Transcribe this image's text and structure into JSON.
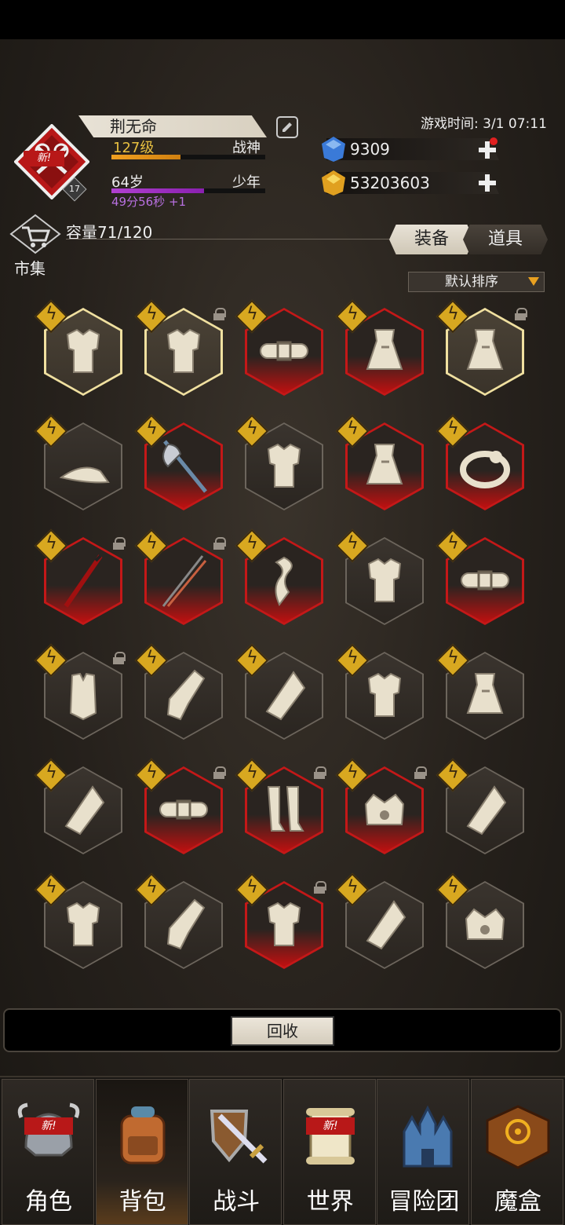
{
  "profile": {
    "name": "荆无命",
    "level": "127级",
    "title": "战神",
    "age": "64岁",
    "stage": "少年",
    "timer": "49分56秒 +1",
    "badge_level": "17",
    "new_tag": "新!",
    "xp_progress": 0.45,
    "age_progress": 0.6
  },
  "game_time": "游戏时间: 3/1 07:11",
  "resources": {
    "gems": "9309",
    "gold": "53203603"
  },
  "market": {
    "label": "市集"
  },
  "inventory": {
    "capacity": "容量71/120",
    "tabs": [
      "装备",
      "道具"
    ],
    "sort_label": "默认排序"
  },
  "items": [
    {
      "icon": "armor-icon",
      "frame": "gold",
      "locked": false
    },
    {
      "icon": "armor-icon",
      "frame": "gold",
      "locked": true
    },
    {
      "icon": "belt-icon",
      "frame": "red",
      "locked": false
    },
    {
      "icon": "robe-icon",
      "frame": "red",
      "locked": false
    },
    {
      "icon": "robe-icon",
      "frame": "gold",
      "locked": true
    },
    {
      "icon": "hat-icon",
      "frame": "normal",
      "locked": false
    },
    {
      "icon": "axe-icon",
      "frame": "red",
      "locked": false
    },
    {
      "icon": "armor-icon",
      "frame": "normal",
      "locked": false
    },
    {
      "icon": "robe-icon",
      "frame": "red",
      "locked": false
    },
    {
      "icon": "ring-icon",
      "frame": "red",
      "locked": false
    },
    {
      "icon": "spear-icon",
      "frame": "red",
      "locked": true
    },
    {
      "icon": "twin-spear-icon",
      "frame": "red",
      "locked": true
    },
    {
      "icon": "scarf-icon",
      "frame": "red",
      "locked": false
    },
    {
      "icon": "armor-icon",
      "frame": "normal",
      "locked": false
    },
    {
      "icon": "belt-icon",
      "frame": "red",
      "locked": false
    },
    {
      "icon": "vest-icon",
      "frame": "normal",
      "locked": true
    },
    {
      "icon": "gauntlet-icon",
      "frame": "normal",
      "locked": false
    },
    {
      "icon": "bracer-icon",
      "frame": "normal",
      "locked": false
    },
    {
      "icon": "armor-icon",
      "frame": "normal",
      "locked": false
    },
    {
      "icon": "robe-icon",
      "frame": "normal",
      "locked": false
    },
    {
      "icon": "bracer-icon",
      "frame": "normal",
      "locked": false
    },
    {
      "icon": "belt-icon",
      "frame": "red",
      "locked": true
    },
    {
      "icon": "boots-icon",
      "frame": "red",
      "locked": true
    },
    {
      "icon": "crown-icon",
      "frame": "red",
      "locked": true
    },
    {
      "icon": "bracer-icon",
      "frame": "normal",
      "locked": false
    },
    {
      "icon": "armor-icon",
      "frame": "normal",
      "locked": false
    },
    {
      "icon": "gauntlet-icon",
      "frame": "normal",
      "locked": false
    },
    {
      "icon": "armor-icon",
      "frame": "red",
      "locked": true
    },
    {
      "icon": "bracer-icon",
      "frame": "normal",
      "locked": false
    },
    {
      "icon": "crown-icon",
      "frame": "normal",
      "locked": false
    }
  ],
  "recycle": {
    "label": "回收"
  },
  "nav": [
    {
      "label": "角色",
      "icon": "helmet-icon",
      "new": true
    },
    {
      "label": "背包",
      "icon": "backpack-icon",
      "new": false,
      "active": true
    },
    {
      "label": "战斗",
      "icon": "sword-shield-icon",
      "new": false
    },
    {
      "label": "世界",
      "icon": "scroll-icon",
      "new": true
    },
    {
      "label": "冒险团",
      "icon": "castle-icon",
      "new": false
    },
    {
      "label": "魔盒",
      "icon": "magic-box-icon",
      "new": false
    }
  ],
  "colors": {
    "accent_gold": "#e8c040",
    "rare_red": "#c41818",
    "xp_orange": "#f0a020",
    "age_purple": "#b040d0"
  }
}
